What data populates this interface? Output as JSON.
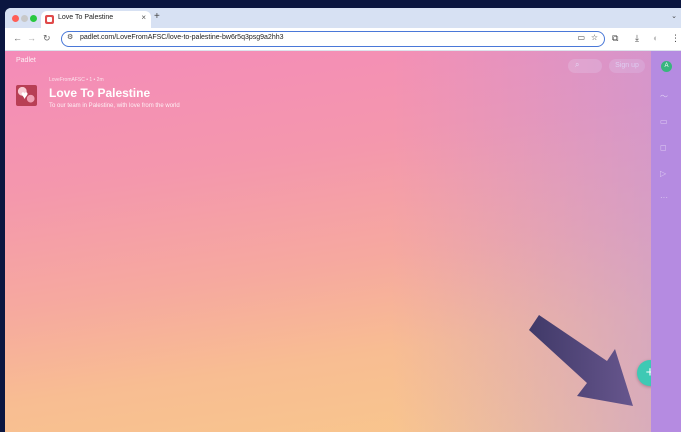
{
  "browser": {
    "tab_title": "Love To Palestine",
    "tab_close": "×",
    "new_tab": "+",
    "tab_menu": "⌄",
    "url": "padlet.com/LoveFromAFSC/love-to-palestine-bw6r5q3psg9a2hh3",
    "icons": [
      "back-icon",
      "forward-icon",
      "reload-icon",
      "site-settings-icon",
      "cast-icon",
      "star-icon",
      "extensions-icon",
      "download-icon",
      "profile-icon",
      "menu-icon"
    ]
  },
  "padlet": {
    "brand": "Padlet",
    "meta": "LoveFromAFSC • 1 • 2m",
    "title": "Love To Palestine",
    "subtitle": "To our team in Palestine, with love from the world",
    "signup_label": "Sign up",
    "fab_label": "+",
    "accent": "#3ec9b4",
    "rail_avatar": "A"
  }
}
